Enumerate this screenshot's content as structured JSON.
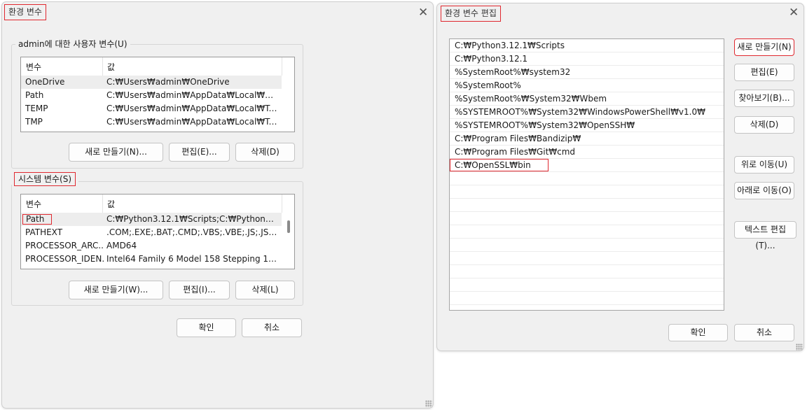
{
  "env_window": {
    "title": "환경 변수",
    "close": "✕",
    "user_group": {
      "legend": "admin에 대한 사용자 변수(U)",
      "headers": [
        "변수",
        "값"
      ],
      "rows": [
        {
          "name": "OneDrive",
          "value": "C:₩Users₩admin₩OneDrive"
        },
        {
          "name": "Path",
          "value": "C:₩Users₩admin₩AppData₩Local₩Micros..."
        },
        {
          "name": "TEMP",
          "value": "C:₩Users₩admin₩AppData₩Local₩Temp"
        },
        {
          "name": "TMP",
          "value": "C:₩Users₩admin₩AppData₩Local₩Temp"
        }
      ],
      "btn_new": "새로 만들기(N)...",
      "btn_edit": "편집(E)...",
      "btn_delete": "삭제(D)"
    },
    "system_group": {
      "legend": "시스템 변수(S)",
      "headers": [
        "변수",
        "값"
      ],
      "rows": [
        {
          "name": "Path",
          "value": "C:₩Python3.12.1₩Scripts;C:₩Python3.12.1..."
        },
        {
          "name": "PATHEXT",
          "value": ".COM;.EXE;.BAT;.CMD;.VBS;.VBE;.JS;.JSE;.W..."
        },
        {
          "name": "PROCESSOR_ARC...",
          "value": "AMD64"
        },
        {
          "name": "PROCESSOR_IDEN...",
          "value": "Intel64 Family 6 Model 158 Stepping 10, ..."
        }
      ],
      "btn_new": "새로 만들기(W)...",
      "btn_edit": "편집(I)...",
      "btn_delete": "삭제(L)"
    },
    "btn_ok": "확인",
    "btn_cancel": "취소"
  },
  "edit_window": {
    "title": "환경 변수 편집",
    "close": "✕",
    "paths": [
      "C:₩Python3.12.1₩Scripts",
      "C:₩Python3.12.1",
      "%SystemRoot%₩system32",
      "%SystemRoot%",
      "%SystemRoot%₩System32₩Wbem",
      "%SYSTEMROOT%₩System32₩WindowsPowerShell₩v1.0₩",
      "%SYSTEMROOT%₩System32₩OpenSSH₩",
      "C:₩Program Files₩Bandizip₩",
      "C:₩Program Files₩Git₩cmd",
      "C:₩OpenSSL₩bin"
    ],
    "btn_new": "새로 만들기(N)",
    "btn_edit": "편집(E)",
    "btn_browse": "찾아보기(B)...",
    "btn_delete": "삭제(D)",
    "btn_up": "위로 이동(U)",
    "btn_down": "아래로 이동(O)",
    "btn_text": "텍스트 편집(T)...",
    "btn_ok": "확인",
    "btn_cancel": "취소"
  }
}
